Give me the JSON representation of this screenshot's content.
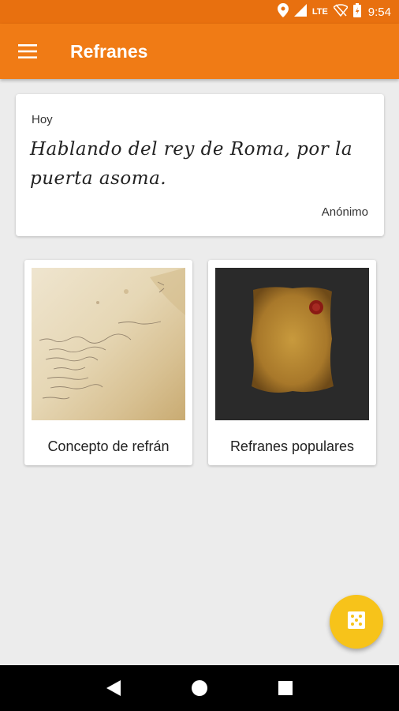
{
  "status_bar": {
    "network": "LTE",
    "time": "9:54",
    "icons": [
      "location-icon",
      "signal-icon",
      "wifi-off-icon",
      "battery-icon"
    ]
  },
  "app_bar": {
    "title": "Refranes",
    "menu_icon": "hamburger-menu-icon",
    "background": "#f07b15"
  },
  "daily_quote": {
    "label": "Hoy",
    "text": "Hablando del rey de Roma, por la puerta asoma.",
    "author": "Anónimo"
  },
  "tiles": [
    {
      "label": "Concepto de refrán",
      "image": "old-handwritten-letter"
    },
    {
      "label": "Refranes populares",
      "image": "parchment-with-wax-seal"
    }
  ],
  "fab": {
    "icon": "dice-icon",
    "color": "#f7c31a"
  },
  "nav_bar": {
    "items": [
      "back-icon",
      "home-icon",
      "recents-icon"
    ]
  }
}
